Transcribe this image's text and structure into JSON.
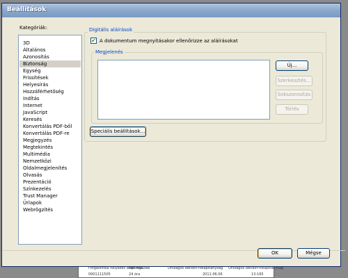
{
  "window": {
    "title": "Beállítások"
  },
  "categories": {
    "label": "Kategóriák:",
    "items": [
      "3D",
      "Általános",
      "Azonosítás",
      "Biztonság",
      "Egység",
      "Frissítések",
      "Helyesírás",
      "Hozzáférhetőség",
      "Indítás",
      "Internet",
      "JavaScript",
      "Keresés",
      "Konvertálás PDF-ből",
      "Konvertálás PDF-re",
      "Megjegyzés",
      "Megtekintés",
      "Multimédia",
      "Nemzetközi",
      "Oldalmegjelenítés",
      "Olvasás",
      "Prezentáció",
      "Színkezelés",
      "Trust Manager",
      "Űrlapok",
      "Webrögzítés"
    ],
    "selected": "Biztonság"
  },
  "digital_signatures": {
    "title": "Digitális aláírások",
    "verify_checkbox": {
      "label": "A dokumentum megnyitásakor ellenőrizze az aláírásokat",
      "checked": true,
      "mark": "✔"
    },
    "appearance": {
      "title": "Megjelenés",
      "buttons": {
        "new": "Új...",
        "edit": "Szerkesztés...",
        "duplicate": "Sokszorosítás",
        "delete": "Törlés"
      }
    },
    "advanced_button": "Speciális beállítások..."
  },
  "footer": {
    "ok": "OK",
    "cancel": "Mégse"
  },
  "background_doc": {
    "row1": [
      "Forgalomba helyezés időpontja",
      "fúrt közúzás",
      "Országos Rendőr-főkapitányság",
      "Országos Rendőr-főkapitányság"
    ],
    "row2": [
      "0901111505",
      "24 óra",
      "2011.06.06",
      "13:165"
    ]
  }
}
